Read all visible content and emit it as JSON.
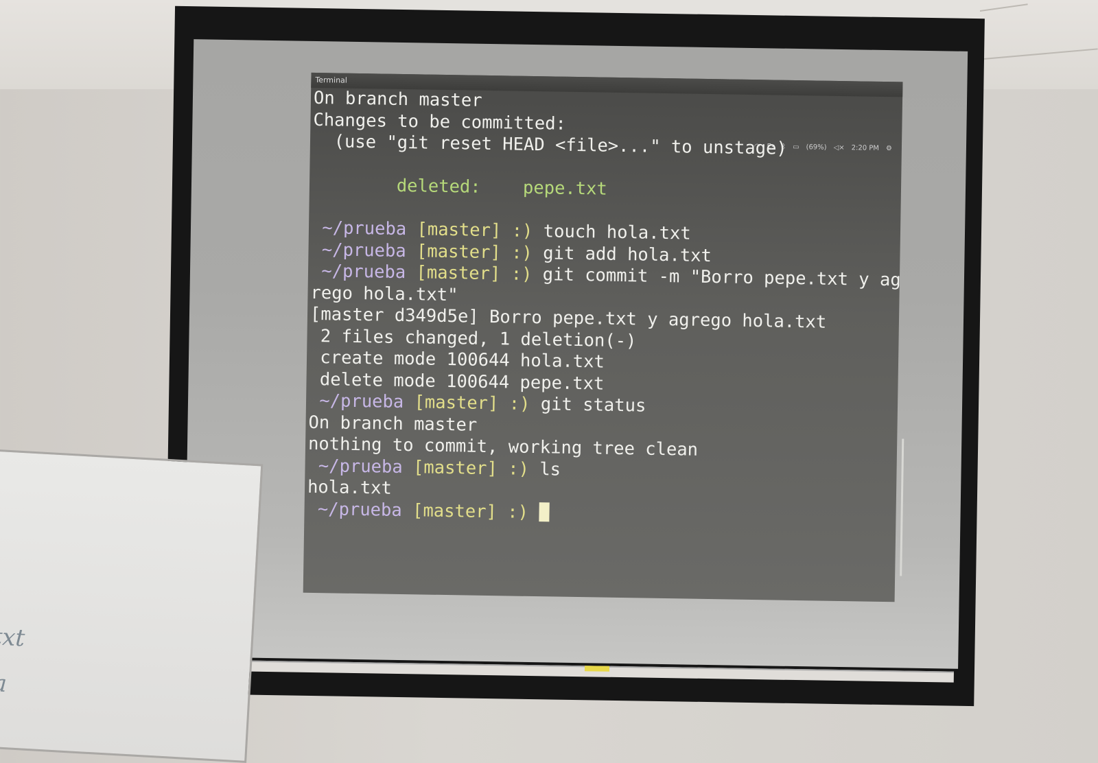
{
  "terminal": {
    "title": "Terminal",
    "indicators": {
      "lang": "Es",
      "battery": "(69%)",
      "time": "2:20 PM"
    },
    "lines": [
      {
        "type": "out",
        "text": "On branch master"
      },
      {
        "type": "out",
        "text": "Changes to be committed:"
      },
      {
        "type": "out",
        "text": "  (use \"git reset HEAD <file>...\" to unstage)"
      },
      {
        "type": "blank",
        "text": ""
      },
      {
        "type": "deleted",
        "label": "        deleted:",
        "file": "    pepe.txt"
      },
      {
        "type": "blank",
        "text": ""
      },
      {
        "type": "prompt",
        "path": " ~/prueba",
        "branch": "[master]",
        "smile": ":)",
        "cmd": "touch hola.txt"
      },
      {
        "type": "prompt",
        "path": " ~/prueba",
        "branch": "[master]",
        "smile": ":)",
        "cmd": "git add hola.txt"
      },
      {
        "type": "prompt",
        "path": " ~/prueba",
        "branch": "[master]",
        "smile": ":)",
        "cmd": "git commit -m \"Borro pepe.txt y ag"
      },
      {
        "type": "out",
        "text": "rego hola.txt\""
      },
      {
        "type": "out",
        "text": "[master d349d5e] Borro pepe.txt y agrego hola.txt"
      },
      {
        "type": "out",
        "text": " 2 files changed, 1 deletion(-)"
      },
      {
        "type": "out",
        "text": " create mode 100644 hola.txt"
      },
      {
        "type": "out",
        "text": " delete mode 100644 pepe.txt"
      },
      {
        "type": "prompt",
        "path": " ~/prueba",
        "branch": "[master]",
        "smile": ":)",
        "cmd": "git status"
      },
      {
        "type": "out",
        "text": "On branch master"
      },
      {
        "type": "out",
        "text": "nothing to commit, working tree clean"
      },
      {
        "type": "prompt",
        "path": " ~/prueba",
        "branch": "[master]",
        "smile": ":)",
        "cmd": "ls"
      },
      {
        "type": "out",
        "text": "hola.txt"
      },
      {
        "type": "prompt",
        "path": " ~/prueba",
        "branch": "[master]",
        "smile": ":)",
        "cmd": ""
      }
    ]
  },
  "whiteboard": {
    "writing": [
      "txt",
      "ta"
    ]
  },
  "colors": {
    "deleted": "#b6d97a",
    "path": "#c7b7e6",
    "branch": "#e2de8a"
  }
}
